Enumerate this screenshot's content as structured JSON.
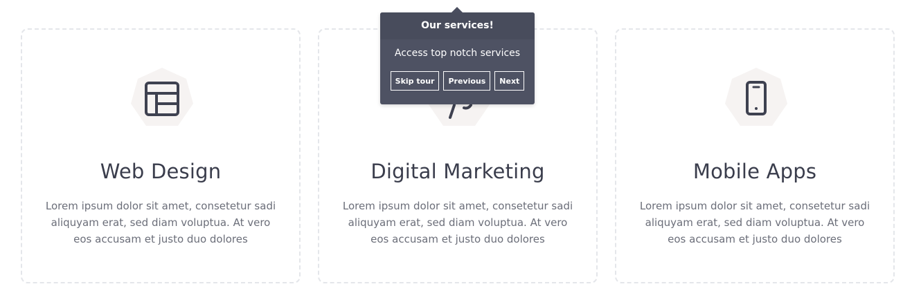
{
  "cards": [
    {
      "icon": "layout-icon",
      "title": "Web Design",
      "text": "Lorem ipsum dolor sit amet, consetetur sadi aliquyam erat, sed diam voluptua. At vero eos accusam et justo duo dolores"
    },
    {
      "icon": "marketing-icon",
      "title": "Digital Marketing",
      "text": "Lorem ipsum dolor sit amet, consetetur sadi aliquyam erat, sed diam voluptua. At vero eos accusam et justo duo dolores"
    },
    {
      "icon": "mobile-phone-icon",
      "title": "Mobile Apps",
      "text": "Lorem ipsum dolor sit amet, consetetur sadi aliquyam erat, sed diam voluptua. At vero eos accusam et justo duo dolores"
    }
  ],
  "tour": {
    "title": "Our services!",
    "body": "Access top notch services",
    "skip_label": "Skip tour",
    "previous_label": "Previous",
    "next_label": "Next"
  },
  "colors": {
    "tour_bg": "#4e5263",
    "tour_header_bg": "#484c5c",
    "badge_bg": "#f6f3f2",
    "icon_stroke": "#3e4150",
    "card_border": "#e4e6ea"
  }
}
